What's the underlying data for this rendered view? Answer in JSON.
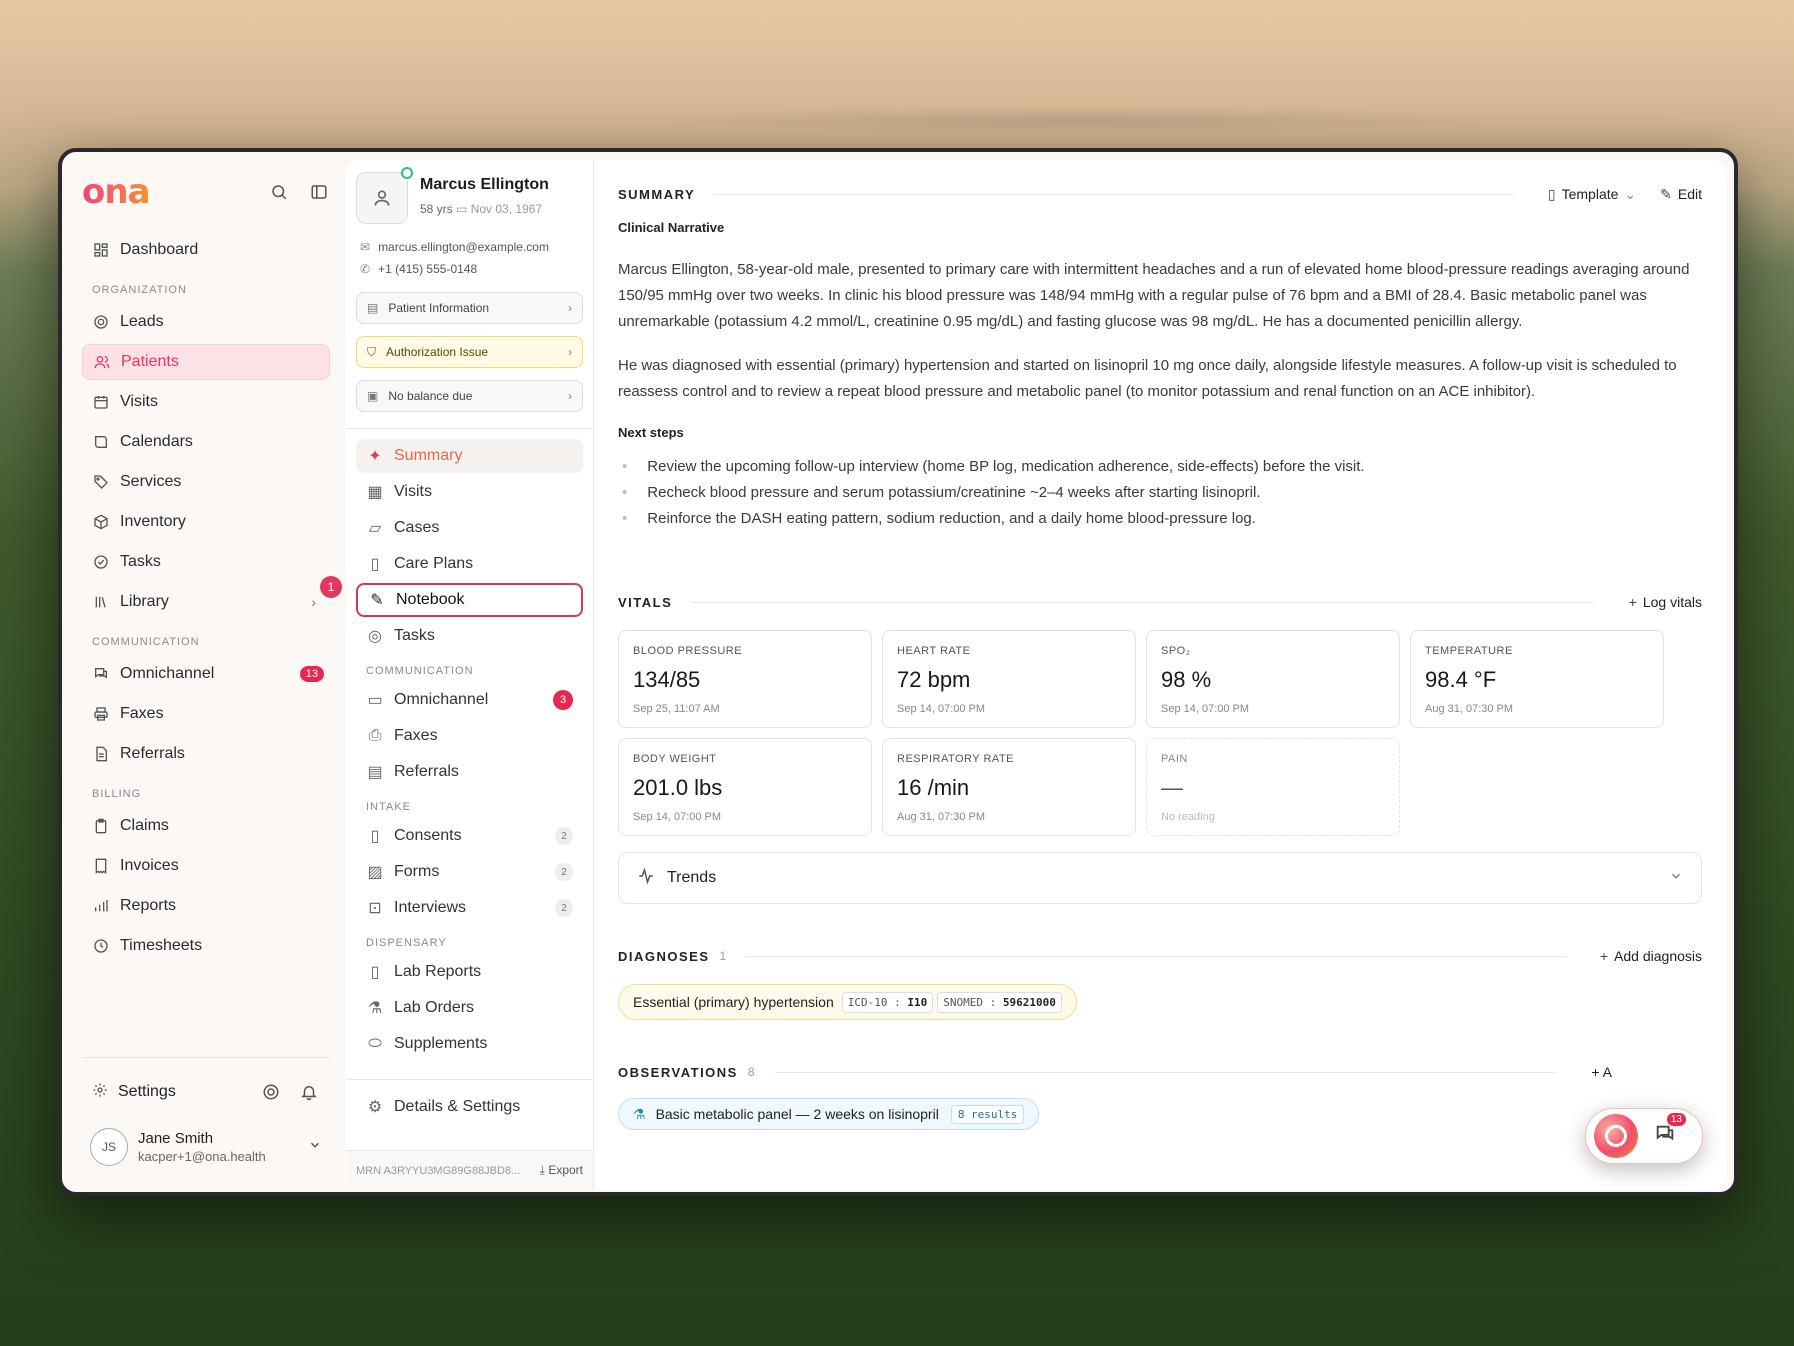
{
  "brand": {
    "logo": "ona"
  },
  "nav": {
    "dashboard": "Dashboard",
    "sections": {
      "organization": "ORGANIZATION",
      "communication": "COMMUNICATION",
      "billing": "BILLING"
    },
    "items": {
      "leads": "Leads",
      "patients": "Patients",
      "visits": "Visits",
      "calendars": "Calendars",
      "services": "Services",
      "inventory": "Inventory",
      "tasks": "Tasks",
      "library": "Library",
      "omnichannel": "Omnichannel",
      "omnichannel_badge": "13",
      "faxes": "Faxes",
      "referrals": "Referrals",
      "claims": "Claims",
      "invoices": "Invoices",
      "reports": "Reports",
      "timesheets": "Timesheets"
    },
    "step_badge": "1",
    "settings": "Settings",
    "user": {
      "initials": "JS",
      "name": "Jane Smith",
      "email": "kacper+1@ona.health"
    }
  },
  "patient": {
    "name": "Marcus Ellington",
    "age": "58 yrs",
    "dob": "Nov 03, 1967",
    "email": "marcus.ellington@example.com",
    "phone": "+1 (415) 555-0148",
    "buttons": {
      "info": "Patient Information",
      "auth": "Authorization Issue",
      "balance": "No balance due"
    },
    "menu": {
      "summary": "Summary",
      "visits": "Visits",
      "cases": "Cases",
      "care_plans": "Care Plans",
      "notebook": "Notebook",
      "tasks": "Tasks",
      "communication": "COMMUNICATION",
      "omnichannel": "Omnichannel",
      "omnichannel_badge": "3",
      "faxes": "Faxes",
      "referrals": "Referrals",
      "intake": "INTAKE",
      "consents": "Consents",
      "consents_count": "2",
      "forms": "Forms",
      "forms_count": "2",
      "interviews": "Interviews",
      "interviews_count": "2",
      "dispensary": "DISPENSARY",
      "lab_reports": "Lab Reports",
      "lab_orders": "Lab Orders",
      "supplements": "Supplements",
      "details": "Details & Settings"
    },
    "mrn": "MRN A3RYYU3MG89G88JBD8...",
    "export": "Export"
  },
  "summary": {
    "title": "SUMMARY",
    "template": "Template",
    "edit": "Edit",
    "narrative_label": "Clinical Narrative",
    "para1": "Marcus Ellington, 58-year-old male, presented to primary care with intermittent headaches and a run of elevated home blood-pressure readings averaging around 150/95 mmHg over two weeks. In clinic his blood pressure was 148/94 mmHg with a regular pulse of 76 bpm and a BMI of 28.4. Basic metabolic panel was unremarkable (potassium 4.2 mmol/L, creatinine 0.95 mg/dL) and fasting glucose was 98 mg/dL. He has a documented penicillin allergy.",
    "para2": "He was diagnosed with essential (primary) hypertension and started on lisinopril 10 mg once daily, alongside lifestyle measures. A follow-up visit is scheduled to reassess control and to review a repeat blood pressure and metabolic panel (to monitor potassium and renal function on an ACE inhibitor).",
    "next_label": "Next steps",
    "steps": [
      "Review the upcoming follow-up interview (home BP log, medication adherence, side-effects) before the visit.",
      "Recheck blood pressure and serum potassium/creatinine ~2–4 weeks after starting lisinopril.",
      "Reinforce the DASH eating pattern, sodium reduction, and a daily home blood-pressure log."
    ]
  },
  "vitals": {
    "title": "VITALS",
    "action": "Log vitals",
    "cards": [
      {
        "label": "BLOOD PRESSURE",
        "value": "134/85",
        "time": "Sep 25, 11:07 AM"
      },
      {
        "label": "HEART RATE",
        "value": "72 bpm",
        "time": "Sep 14, 07:00 PM"
      },
      {
        "label": "SPO₂",
        "value": "98 %",
        "time": "Sep 14, 07:00 PM"
      },
      {
        "label": "TEMPERATURE",
        "value": "98.4 °F",
        "time": "Aug 31, 07:30 PM"
      },
      {
        "label": "BODY WEIGHT",
        "value": "201.0 lbs",
        "time": "Sep 14, 07:00 PM"
      },
      {
        "label": "RESPIRATORY RATE",
        "value": "16 /min",
        "time": "Aug 31, 07:30 PM"
      },
      {
        "label": "PAIN",
        "value": "—",
        "time": "No reading"
      }
    ],
    "trends": "Trends"
  },
  "diagnoses": {
    "title": "DIAGNOSES",
    "count": "1",
    "action": "Add diagnosis",
    "item": "Essential (primary) hypertension",
    "icd_label": "ICD-10 :",
    "icd_code": "I10",
    "snomed_label": "SNOMED :",
    "snomed_code": "59621000"
  },
  "observations": {
    "title": "OBSERVATIONS",
    "count": "8",
    "action": "+ A",
    "item": "Basic metabolic panel — 2 weeks on lisinopril",
    "results": "8 results"
  },
  "fab": {
    "badge": "13"
  },
  "colors": {
    "accent": "#e0385f",
    "brand_orange": "#f7902f"
  }
}
